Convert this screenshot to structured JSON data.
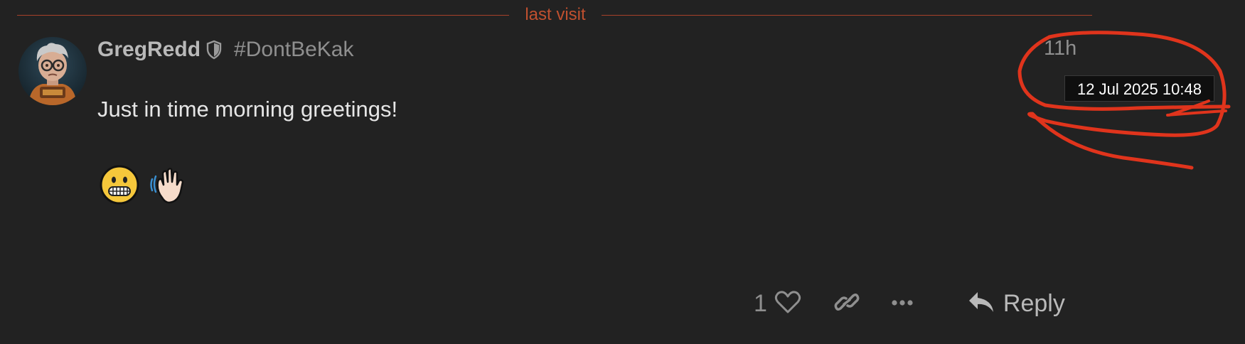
{
  "divider": {
    "label": "last visit",
    "color": "#c0502f"
  },
  "post": {
    "username": "GregRedd",
    "user_title": "#DontBeKak",
    "relative_time": "11h",
    "timestamp_tooltip": "12 Jul 2025 10:48",
    "text": "Just in time morning greetings!",
    "emojis": [
      "grinning-face-icon",
      "waving-hand-icon"
    ],
    "like_count": "1",
    "reply_label": "Reply"
  },
  "annotation": {
    "color": "#e0341c",
    "shape": "hand-drawn circle around timestamp"
  },
  "icons": {
    "moderator": "shield-icon",
    "like": "heart-icon",
    "link": "link-icon",
    "more": "ellipsis-icon",
    "reply": "reply-arrow-icon"
  }
}
